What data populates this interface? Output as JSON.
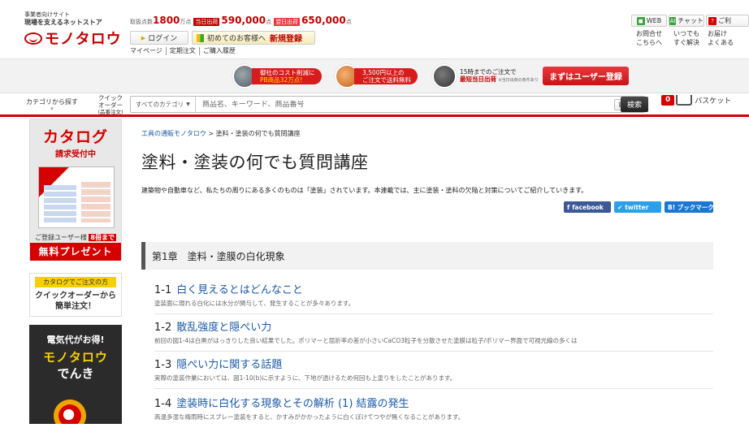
{
  "header": {
    "logo_tagline_1": "事業者向けサイト",
    "logo_tagline_2": "現場を支えるネットストア",
    "logo_text": "モノタロウ",
    "stats": {
      "items_label": "取扱点数",
      "items_count": "1800",
      "items_unit": "万点",
      "today_tag": "当日出荷",
      "today_count": "590,000",
      "today_unit": "点",
      "tomorrow_tag": "翌日出荷",
      "tomorrow_count": "650,000",
      "tomorrow_unit": "点"
    },
    "login_label": "ログイン",
    "first_label": "初めてのお客様へ",
    "register_label": "新規登録",
    "sublinks": [
      "マイページ",
      "定期注文",
      "ご購入履歴"
    ],
    "help": [
      {
        "button": "WEB",
        "icon": "web-icon",
        "line1": "お問合せ",
        "line2": "こちらへ",
        "color": "#3aa63a"
      },
      {
        "button": "チャット",
        "icon": "chat-icon",
        "line1": "いつでも",
        "line2": "すぐ解決",
        "color": "#3aa63a"
      },
      {
        "button": "ご利",
        "icon": "question-icon",
        "line1": "お届け",
        "line2": "よくある",
        "color": "#d50000"
      }
    ]
  },
  "banner": {
    "item1_line1": "御社のコスト削減に",
    "item1_line2": "PB商品32万点!",
    "item2_line1": "3,500円以上の",
    "item2_line2": "ご注文で送料無料",
    "item3_line1": "15時までのご注文で",
    "item3_line2": "最短当日出荷",
    "item3_note": "※当日出荷の条件あり",
    "cta_label": "まずはユーザー登録"
  },
  "searchbar": {
    "category_label": "カテゴリから探す",
    "quick_label_1": "クイック",
    "quick_label_2": "オーダー",
    "quick_label_3": "(品番注文)",
    "scope_label": "すべてのカテゴリ",
    "placeholder": "商品名、キーワード、商品番号",
    "detail_label": "詳細",
    "search_label": "検索",
    "cart_count": "0",
    "cart_label": "バスケット"
  },
  "sidebar": {
    "catalog_title": "カタログ",
    "catalog_sub": "請求受付中",
    "catalog_users": "ご登録ユーザー様",
    "catalog_days": "8冊まで",
    "catalog_free": "無料プレゼント",
    "quick_head": "カタログでご注文の方",
    "quick_line1": "クイックオーダーから",
    "quick_line2": "簡単注文！",
    "denki_line1": "電気代がお得!",
    "denki_line2": "モノタロウ",
    "denki_line3": "でんき"
  },
  "main": {
    "breadcrumb_home": "工具の通販モノタロウ",
    "breadcrumb_sep": " > ",
    "breadcrumb_current": "塗料・塗装の何でも質問講座",
    "title": "塗料・塗装の何でも質問講座",
    "lead": "建築物や自動車など、私たちの周りにある多くのものは「塗装」されています。本連載では、主に塗装・塗料の欠陥と対策についてご紹介していきます。",
    "share": {
      "facebook": "facebook",
      "twitter": "twitter",
      "hatena": "B! ブックマーク"
    },
    "chapter": "第1章　塗料・塗膜の白化現象",
    "items": [
      {
        "no": "1-1",
        "title": "白く見えるとはどんなこと",
        "desc": "塗装面に現れる白化には水分が関与して、発生することが多々あります。"
      },
      {
        "no": "1-2",
        "title": "散乱強度と隠ぺい力",
        "desc": "前回の図1-4は白黒がはっきりした良い結果でした。ポリマーと屈折率の差が小さいCaCO3粒子を分散させた塗膜は粒子/ポリマー界面で可視光線の多くは"
      },
      {
        "no": "1-3",
        "title": "隠ぺい力に関する話題",
        "desc": "実際の塗装作業においては、図1-10(b)に示すように、下地が透けるため何回も上塗りをしたことがあります。"
      },
      {
        "no": "1-4",
        "title": "塗装時に白化する現象とその解析 (1) 結露の発生",
        "desc": "高温多湿な梅雨時にスプレー塗装をすると、かすみがかかったように白くぼけてつやが無くなることがあります。"
      }
    ]
  },
  "colors": {
    "brand_red": "#d50000",
    "link_blue": "#1a5aa8",
    "accent_yellow": "#f7d000"
  }
}
